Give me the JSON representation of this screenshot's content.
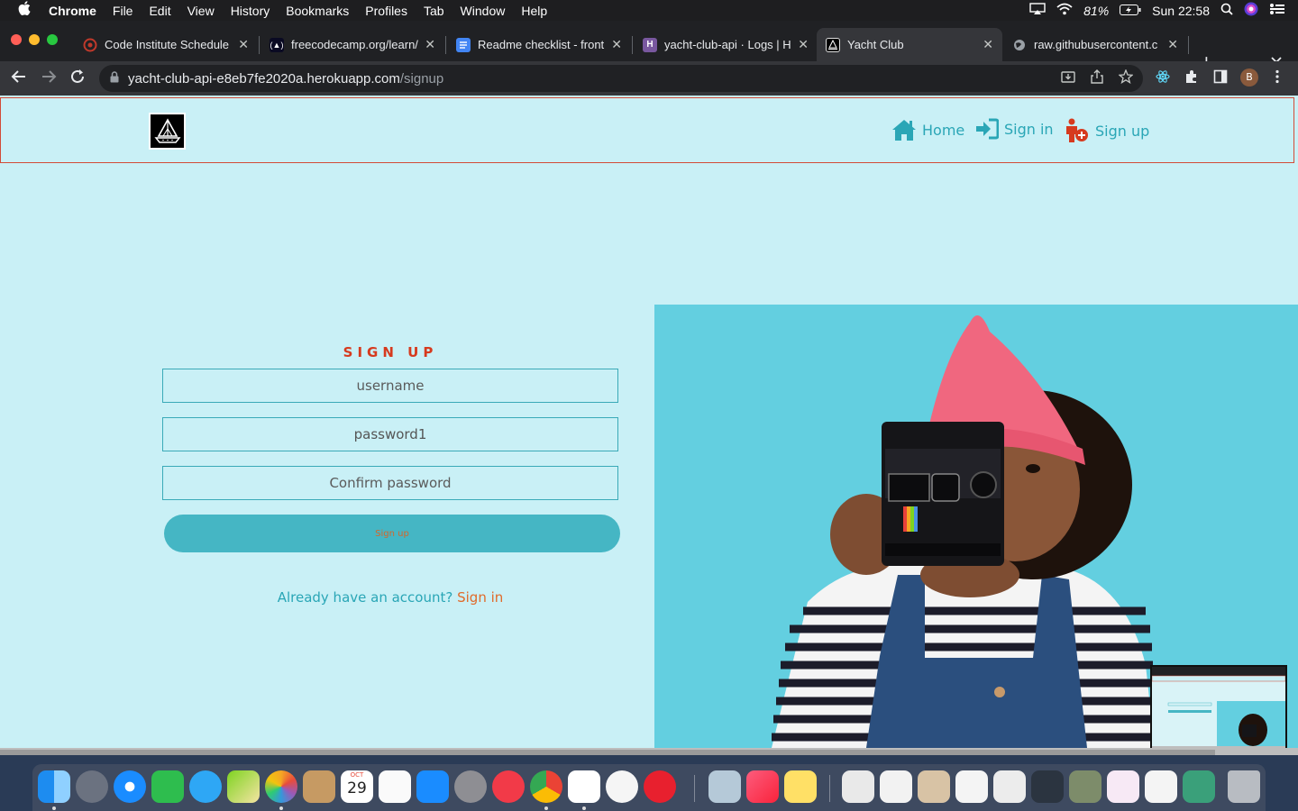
{
  "menubar": {
    "app": "Chrome",
    "items": [
      "File",
      "Edit",
      "View",
      "History",
      "Bookmarks",
      "Profiles",
      "Tab",
      "Window",
      "Help"
    ],
    "battery": "81%",
    "clock": "Sun 22:58"
  },
  "tabs": [
    {
      "title": "Code Institute Schedule",
      "icon": "code-institute-icon",
      "color": "#c0392b"
    },
    {
      "title": "freecodecamp.org/learn/",
      "icon": "freecodecamp-icon",
      "color": "#0a0a23"
    },
    {
      "title": "Readme checklist - front",
      "icon": "google-docs-icon",
      "color": "#4285f4"
    },
    {
      "title": "yacht-club-api · Logs | H",
      "icon": "heroku-icon",
      "color": "#79589f"
    },
    {
      "title": "Yacht Club",
      "icon": "yacht-club-icon",
      "color": "#000000",
      "active": true
    },
    {
      "title": "raw.githubusercontent.c",
      "icon": "globe-icon",
      "color": "#5f6368"
    }
  ],
  "address": {
    "host": "yacht-club-api-e8eb7fe2020a.herokuapp.com",
    "path": "/signup"
  },
  "profile_initial": "B",
  "site": {
    "nav": {
      "home": "Home",
      "signin": "Sign in",
      "signup": "Sign up"
    },
    "form": {
      "title": "SIGN UP",
      "username_placeholder": "username",
      "password_value": "password1",
      "confirm_placeholder": "Confirm password",
      "submit_label": "Sign up",
      "already_text": "Already have an account?",
      "signin_link": "Sign in"
    }
  },
  "dock": {
    "calendar_month": "OCT",
    "calendar_day": "29"
  },
  "colors": {
    "page_bg": "#c9f0f6",
    "accent_teal": "#2aa6b6",
    "accent_red": "#d63a1e",
    "button_bg": "#45b6c4",
    "hero_bg": "#63cfe0"
  }
}
